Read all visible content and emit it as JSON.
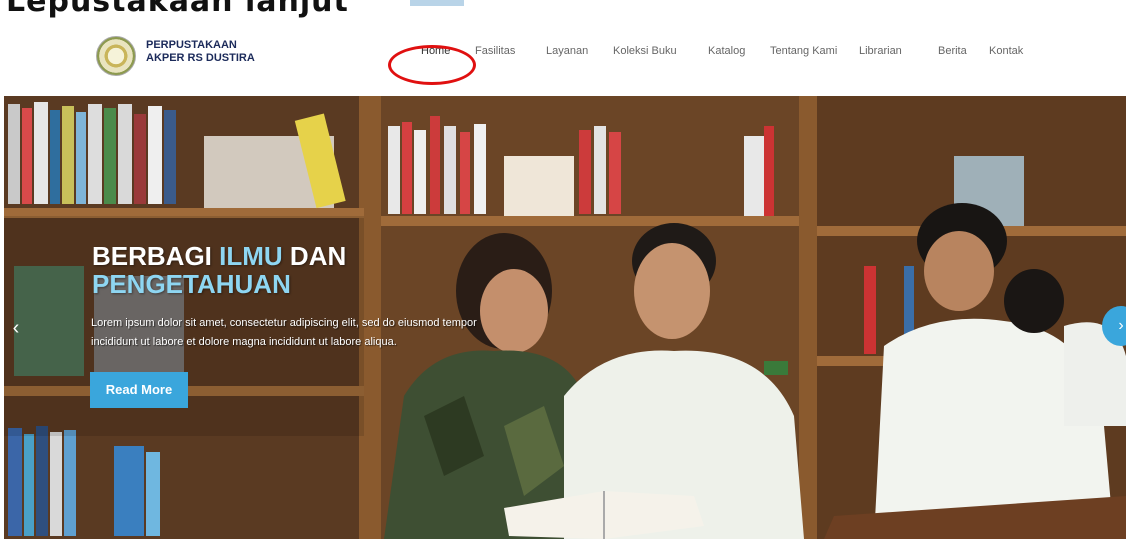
{
  "top_heading_fragment": "Lepustakaan     lanjut",
  "brand": {
    "line1": "PERPUSTAKAAN",
    "line2": "AKPER RS DUSTIRA",
    "logo_icon": "seal-logo-icon"
  },
  "nav": {
    "items": [
      {
        "label": "Home"
      },
      {
        "label": "Fasilitas"
      },
      {
        "label": "Layanan"
      },
      {
        "label": "Koleksi Buku"
      },
      {
        "label": "Katalog"
      },
      {
        "label": "Tentang Kami"
      },
      {
        "label": "Librarian"
      },
      {
        "label": "Berita"
      },
      {
        "label": "Kontak"
      }
    ],
    "highlight_color": "#e01010"
  },
  "hero": {
    "title_word1": "BERBAGI",
    "title_word2": "ILMU",
    "title_word3": "DAN",
    "title_line2": "PENGETAHUAN",
    "description": "Lorem ipsum dolor sit amet, consectetur adipiscing elit, sed do eiusmod tempor incididunt ut labore et dolore magna incididunt ut labore aliqua.",
    "button_label": "Read More",
    "prev_icon": "‹",
    "next_icon": "›",
    "accent_color": "#3aa6dc"
  }
}
